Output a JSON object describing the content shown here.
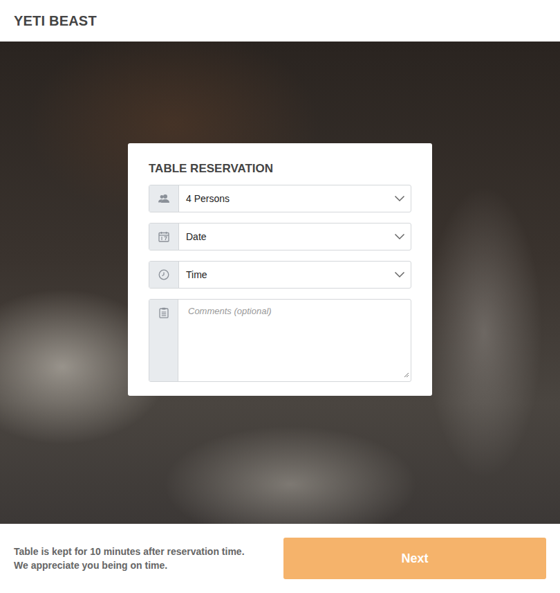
{
  "header": {
    "title": "YETI BEAST"
  },
  "reservation": {
    "title": "TABLE RESERVATION",
    "fields": [
      {
        "kind": "select",
        "icon": "people",
        "value": "4 Persons"
      },
      {
        "kind": "select",
        "icon": "calendar",
        "value": "Date"
      },
      {
        "kind": "select",
        "icon": "clock",
        "value": "Time"
      },
      {
        "kind": "textarea",
        "icon": "clipboard",
        "placeholder": "Comments (optional)"
      }
    ]
  },
  "footer": {
    "note": [
      "Table is kept for 10 minutes after reservation time.",
      "We appreciate you being on time."
    ]
  },
  "buttons": [
    "Next"
  ]
}
